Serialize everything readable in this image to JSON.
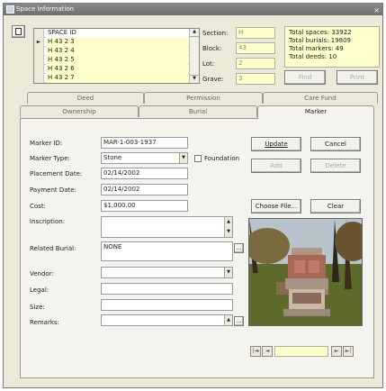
{
  "window": {
    "title": "Space Information",
    "close": "×"
  },
  "grid": {
    "header": "SPACE ID",
    "rows": [
      "H  43  2  3",
      "H  43  2  4",
      "H  43  2  5",
      "H  43  2  6",
      "H  43  2  7"
    ],
    "current_marker": "►"
  },
  "location": {
    "section_label": "Section:",
    "section_value": "H",
    "block_label": "Block:",
    "block_value": "43",
    "lot_label": "Lot:",
    "lot_value": "2",
    "grave_label": "Grave:",
    "grave_value": "3"
  },
  "stats": {
    "total_spaces": "Total spaces: 33922",
    "total_burials": "Total burials: 19809",
    "total_markers": "Total markers: 49",
    "total_deeds": "Total deeds: 10"
  },
  "top_buttons": {
    "find": "Find",
    "print": "Print"
  },
  "tabs": {
    "row1": [
      "Deed",
      "Permission",
      "Care Fund"
    ],
    "row2": [
      "Ownership",
      "Burial",
      "Marker"
    ]
  },
  "marker": {
    "marker_id_label": "Marker ID:",
    "marker_id_value": "MAR-1-003-1937",
    "marker_type_label": "Marker Type:",
    "marker_type_value": "Stone",
    "foundation_label": "Foundation",
    "placement_date_label": "Placement Date:",
    "placement_date_value": "02/14/2002",
    "payment_date_label": "Payment Date:",
    "payment_date_value": "02/14/2002",
    "cost_label": "Cost:",
    "cost_value": "$1,000.00",
    "inscription_label": "Inscription:",
    "related_burial_label": "Related Burial:",
    "related_burial_value": "NONE",
    "vendor_label": "Vendor:",
    "legal_label": "Legal:",
    "size_label": "Size:",
    "remarks_label": "Remarks:"
  },
  "buttons": {
    "update": "Update",
    "cancel": "Cancel",
    "add": "Add",
    "delete": "Delete",
    "choose_file": "Choose File...",
    "clear": "Clear",
    "ellipsis": "..."
  },
  "nav": {
    "first": "|◄",
    "prev": "◄",
    "next": "►",
    "last": "►|"
  }
}
